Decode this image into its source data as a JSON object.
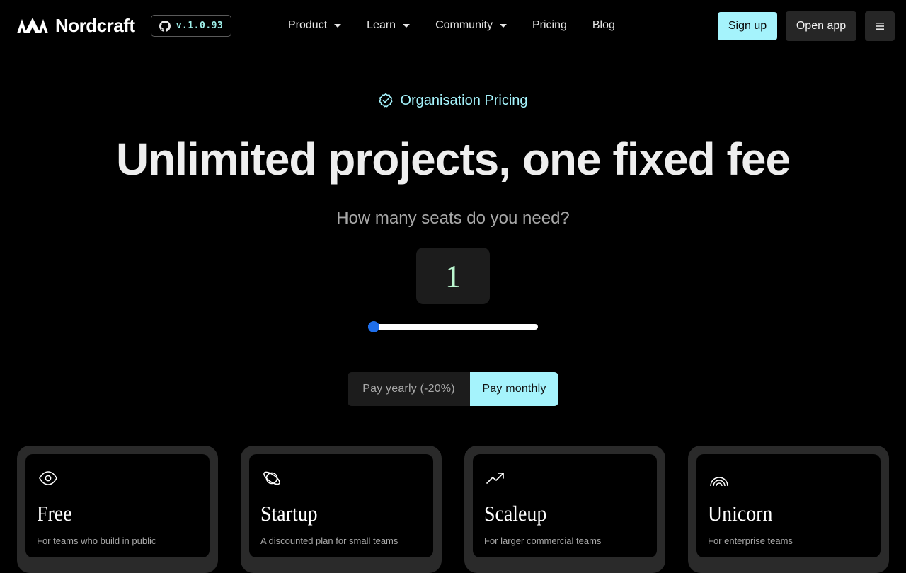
{
  "nav": {
    "brand": "Nordcraft",
    "version": "v.1.0.93",
    "links": [
      {
        "label": "Product",
        "dropdown": true
      },
      {
        "label": "Learn",
        "dropdown": true
      },
      {
        "label": "Community",
        "dropdown": true
      },
      {
        "label": "Pricing",
        "dropdown": false
      },
      {
        "label": "Blog",
        "dropdown": false
      }
    ],
    "signup_label": "Sign up",
    "open_app_label": "Open app"
  },
  "hero": {
    "eyebrow": "Organisation Pricing",
    "title": "Unlimited projects, one fixed fee",
    "seats_question": "How many seats do you need?",
    "seats_value": "1",
    "seats_slider_fraction": 0.0
  },
  "billing": {
    "yearly_label": "Pay yearly (-20%)",
    "monthly_label": "Pay monthly",
    "selected": "monthly"
  },
  "plans": [
    {
      "name": "Free",
      "description": "For teams who build in public",
      "icon": "eye-icon"
    },
    {
      "name": "Startup",
      "description": "A discounted plan for small teams",
      "icon": "planet-icon"
    },
    {
      "name": "Scaleup",
      "description": "For larger commercial teams",
      "icon": "trending-up-icon"
    },
    {
      "name": "Unicorn",
      "description": "For enterprise teams",
      "icon": "rainbow-icon"
    }
  ],
  "colors": {
    "accent": "#a5f3fc",
    "seat_number": "#bbf7d0",
    "slider_thumb": "#1f6feb",
    "background": "#000000"
  }
}
